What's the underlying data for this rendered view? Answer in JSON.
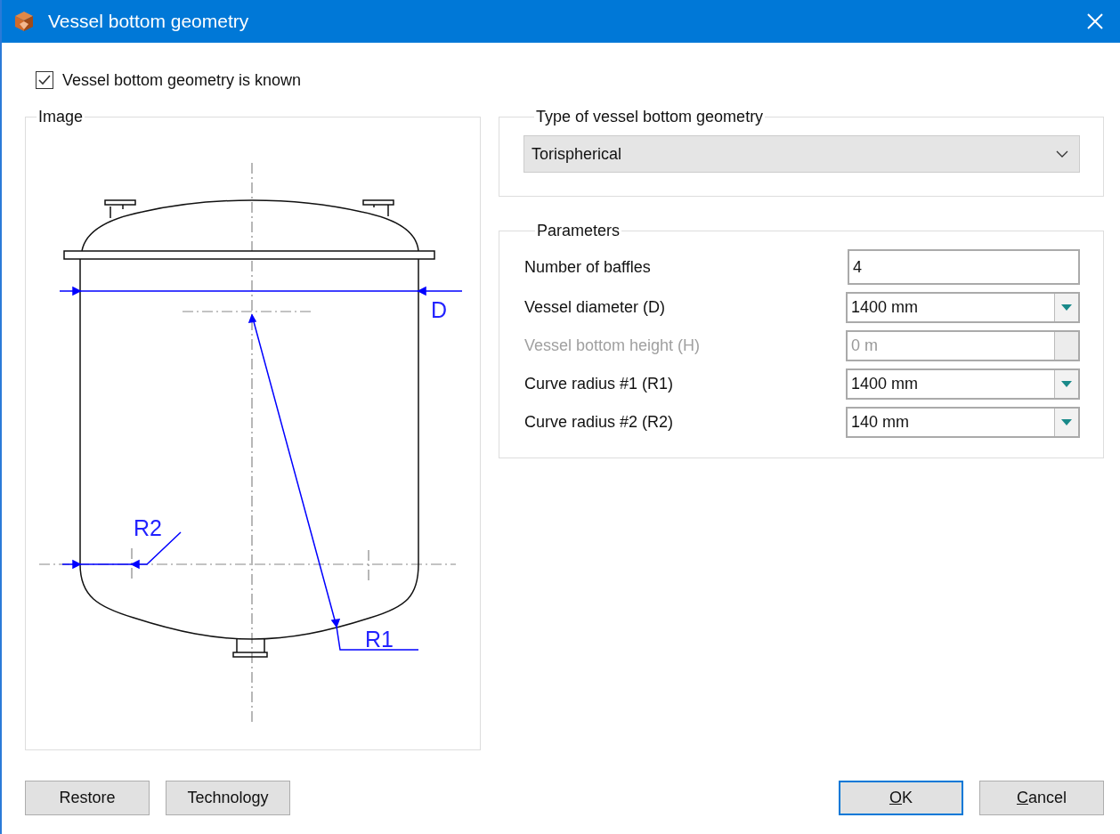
{
  "window": {
    "title": "Vessel bottom geometry"
  },
  "known": {
    "label": "Vessel bottom geometry is known",
    "checked": true
  },
  "image": {
    "title": "Image",
    "labels": [
      "D",
      "R2",
      "R1"
    ]
  },
  "type_group": {
    "title": "Type of vessel bottom geometry",
    "value": "Torispherical"
  },
  "parameters": {
    "title": "Parameters",
    "rows": [
      {
        "label": "Number of baffles",
        "value": "4",
        "kind": "text",
        "disabled": false
      },
      {
        "label": "Vessel diameter (D)",
        "value": "1400 mm",
        "kind": "combo",
        "disabled": false
      },
      {
        "label": "Vessel bottom height (H)",
        "value": "0 m",
        "kind": "combo",
        "disabled": true
      },
      {
        "label": "Curve radius #1 (R1)",
        "value": "1400 mm",
        "kind": "combo",
        "disabled": false
      },
      {
        "label": "Curve radius #2 (R2)",
        "value": "140 mm",
        "kind": "combo",
        "disabled": false
      }
    ]
  },
  "buttons_left": [
    {
      "label": "Restore",
      "underline_first": false
    },
    {
      "label": "Technology",
      "underline_first": false
    }
  ],
  "buttons_right": [
    {
      "label": "OK",
      "underline_first": true,
      "selected": true
    },
    {
      "label": "Cancel",
      "underline_first": true,
      "selected": false
    }
  ]
}
